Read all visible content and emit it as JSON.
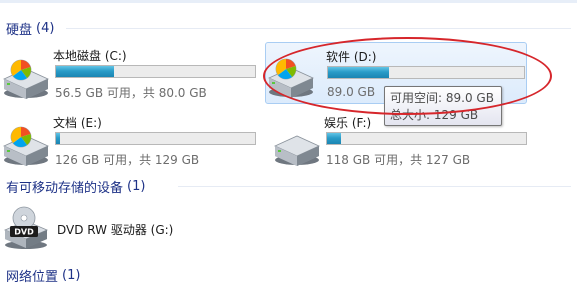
{
  "sections": {
    "hard_disks": {
      "title": "硬盘",
      "count": "(4)"
    },
    "removable": {
      "title": "有可移动存储的设备",
      "count": "(1)"
    },
    "network": {
      "title": "网络位置",
      "count": "(1)"
    }
  },
  "drives": [
    {
      "name": "本地磁盘 (C:)",
      "info": "56.5 GB 可用，共 80.0 GB",
      "used_fraction": 0.29
    },
    {
      "name": "软件 (D:)",
      "info": "89.0 GB",
      "used_fraction": 0.31,
      "selected": true
    },
    {
      "name": "文档 (E:)",
      "info": "126 GB 可用，共 129 GB",
      "used_fraction": 0.02
    },
    {
      "name": "娱乐 (F:)",
      "info": "118 GB 可用，共 127 GB",
      "used_fraction": 0.07
    }
  ],
  "tooltip": {
    "free_space": "可用空间: 89.0 GB",
    "total_size": "总大小: 129 GB"
  },
  "removable_device": {
    "name": "DVD RW 驱动器 (G:)",
    "icon_label": "DVD"
  },
  "colors": {
    "section_header": "#1e3287",
    "bar_fill": "#2a9cc8",
    "annotation_ellipse": "#d6262b",
    "selection": "#dcebfc"
  },
  "icons": {
    "hard_disk": "hard-disk-icon",
    "dvd_drive": "dvd-drive-icon"
  }
}
